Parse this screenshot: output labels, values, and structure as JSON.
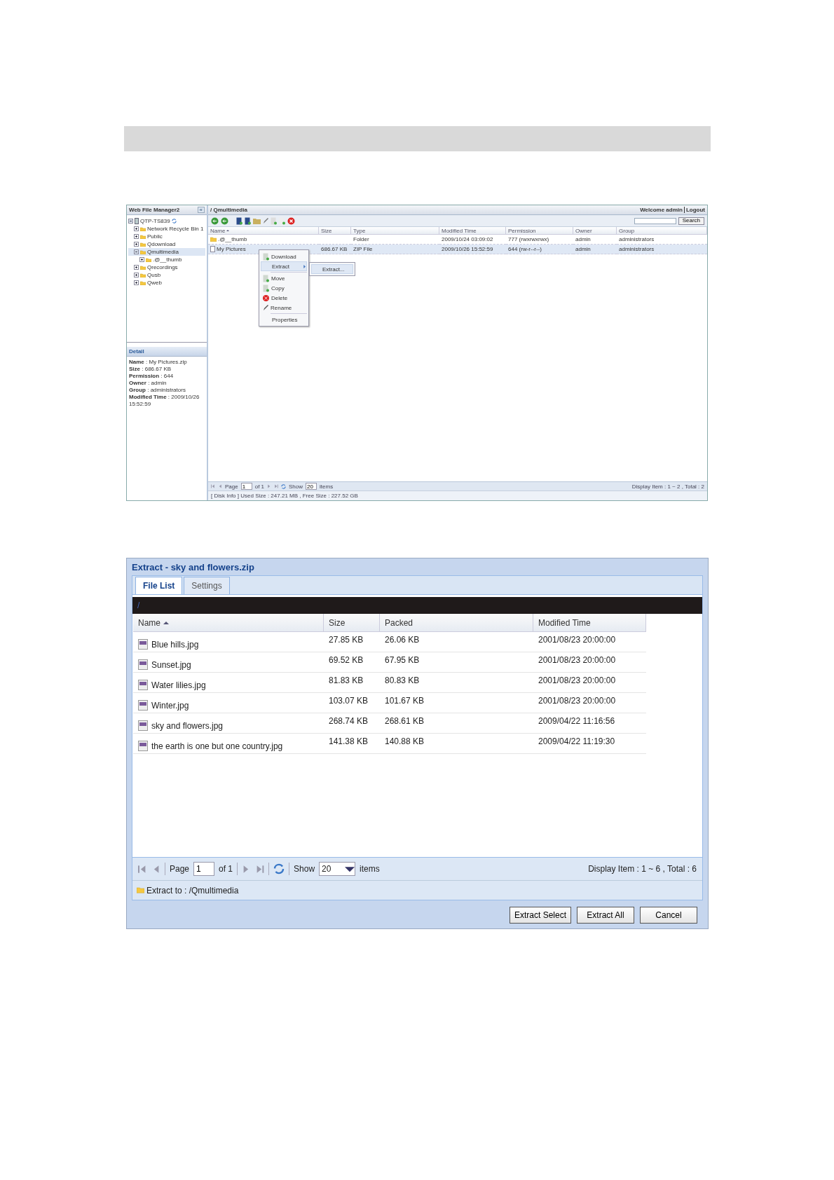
{
  "file_manager": {
    "sidebar": {
      "title": "Web File Manager2",
      "collapse": "«",
      "tree": [
        {
          "label": "QTP-TS839",
          "kind": "server",
          "expanded": true,
          "selected": false,
          "children": [
            {
              "label": "Network Recycle Bin 1",
              "kind": "folder",
              "expanded": false,
              "selected": false
            },
            {
              "label": "Public",
              "kind": "folder",
              "expanded": false,
              "selected": false
            },
            {
              "label": "Qdownload",
              "kind": "folder",
              "expanded": false,
              "selected": false
            },
            {
              "label": "Qmultimedia",
              "kind": "folder",
              "expanded": true,
              "selected": true,
              "children": [
                {
                  "label": ".@__thumb",
                  "kind": "folder",
                  "expanded": false,
                  "selected": false
                }
              ]
            },
            {
              "label": "Qrecordings",
              "kind": "folder",
              "expanded": false,
              "selected": false
            },
            {
              "label": "Qusb",
              "kind": "folder",
              "expanded": false,
              "selected": false
            },
            {
              "label": "Qweb",
              "kind": "folder",
              "expanded": false,
              "selected": false
            }
          ]
        }
      ]
    },
    "detail": {
      "title": "Detail",
      "fields": [
        "**Name** : My Pictures.zip",
        "**Size** : 686.67 KB",
        "**Permission** : 644",
        "**Owner** : admin",
        "**Group** : administrators",
        "**Modified Time** : 2009/10/26 15:52:59"
      ]
    },
    "path": "/ Qmultimedia",
    "welcome": "Welcome admin",
    "logout": "Logout",
    "search_button": "Search",
    "columns": [
      "Name",
      "Size",
      "Type",
      "Modified Time",
      "Permission",
      "Owner",
      "Group"
    ],
    "rows": [
      {
        "kind": "folder",
        "selected": false,
        "cells": [
          ".@__thumb",
          "",
          "Folder",
          "2009/10/24 03:09:02",
          "777 (rwxrwxrwx)",
          "admin",
          "administrators"
        ]
      },
      {
        "kind": "file",
        "selected": true,
        "cells": [
          "My Pictures",
          "686.67 KB",
          "ZIP File",
          "2009/10/26 15:52:59",
          "644 (rw-r--r--)",
          "admin",
          "administrators"
        ]
      }
    ],
    "context_menu": [
      {
        "kind": "download",
        "label": "Download",
        "selected": false
      },
      {
        "kind": "submenu",
        "label": "Extract",
        "selected": true
      },
      {
        "kind": "separator"
      },
      {
        "kind": "move",
        "label": "Move",
        "selected": false
      },
      {
        "kind": "copy",
        "label": "Copy",
        "selected": false
      },
      {
        "kind": "delete",
        "label": "Delete",
        "selected": false
      },
      {
        "kind": "rename",
        "label": "Rename",
        "selected": false
      },
      {
        "kind": "separator"
      },
      {
        "kind": "plain",
        "label": "Properties",
        "selected": false
      }
    ],
    "submenu": [
      "Extract..."
    ],
    "pager": {
      "page_label": "Page",
      "page": "1",
      "of": "of 1",
      "show": "Show",
      "count": "20",
      "items": "items",
      "display": "Display Item : 1 ~ 2 , Total : 2"
    },
    "disk_info": "[ Disk Info ] Used Size : 247.21 MB , Free Size : 227.52 GB"
  },
  "extract_dialog": {
    "title": "Extract - sky and flowers.zip",
    "tabs": [
      {
        "label": "File List",
        "selected": true
      },
      {
        "label": "Settings",
        "selected": false
      }
    ],
    "path": "/",
    "columns": [
      "Name",
      "Size",
      "Packed",
      "Modified Time"
    ],
    "rows": [
      [
        "Blue hills.jpg",
        "27.85 KB",
        "26.06 KB",
        "2001/08/23 20:00:00"
      ],
      [
        "Sunset.jpg",
        "69.52 KB",
        "67.95 KB",
        "2001/08/23 20:00:00"
      ],
      [
        "Water lilies.jpg",
        "81.83 KB",
        "80.83 KB",
        "2001/08/23 20:00:00"
      ],
      [
        "Winter.jpg",
        "103.07 KB",
        "101.67 KB",
        "2001/08/23 20:00:00"
      ],
      [
        "sky and flowers.jpg",
        "268.74 KB",
        "268.61 KB",
        "2009/04/22 11:16:56"
      ],
      [
        "the earth is one but one country.jpg",
        "141.38 KB",
        "140.88 KB",
        "2009/04/22 11:19:30"
      ]
    ],
    "pager": {
      "page_label": "Page",
      "page": "1",
      "of": "of 1",
      "show": "Show",
      "count": "20",
      "items": "items",
      "display": "Display Item : 1 ~ 6 , Total : 6"
    },
    "extract_to": "Extract to : /Qmultimedia",
    "buttons": [
      "Extract Select",
      "Extract All",
      "Cancel"
    ]
  }
}
